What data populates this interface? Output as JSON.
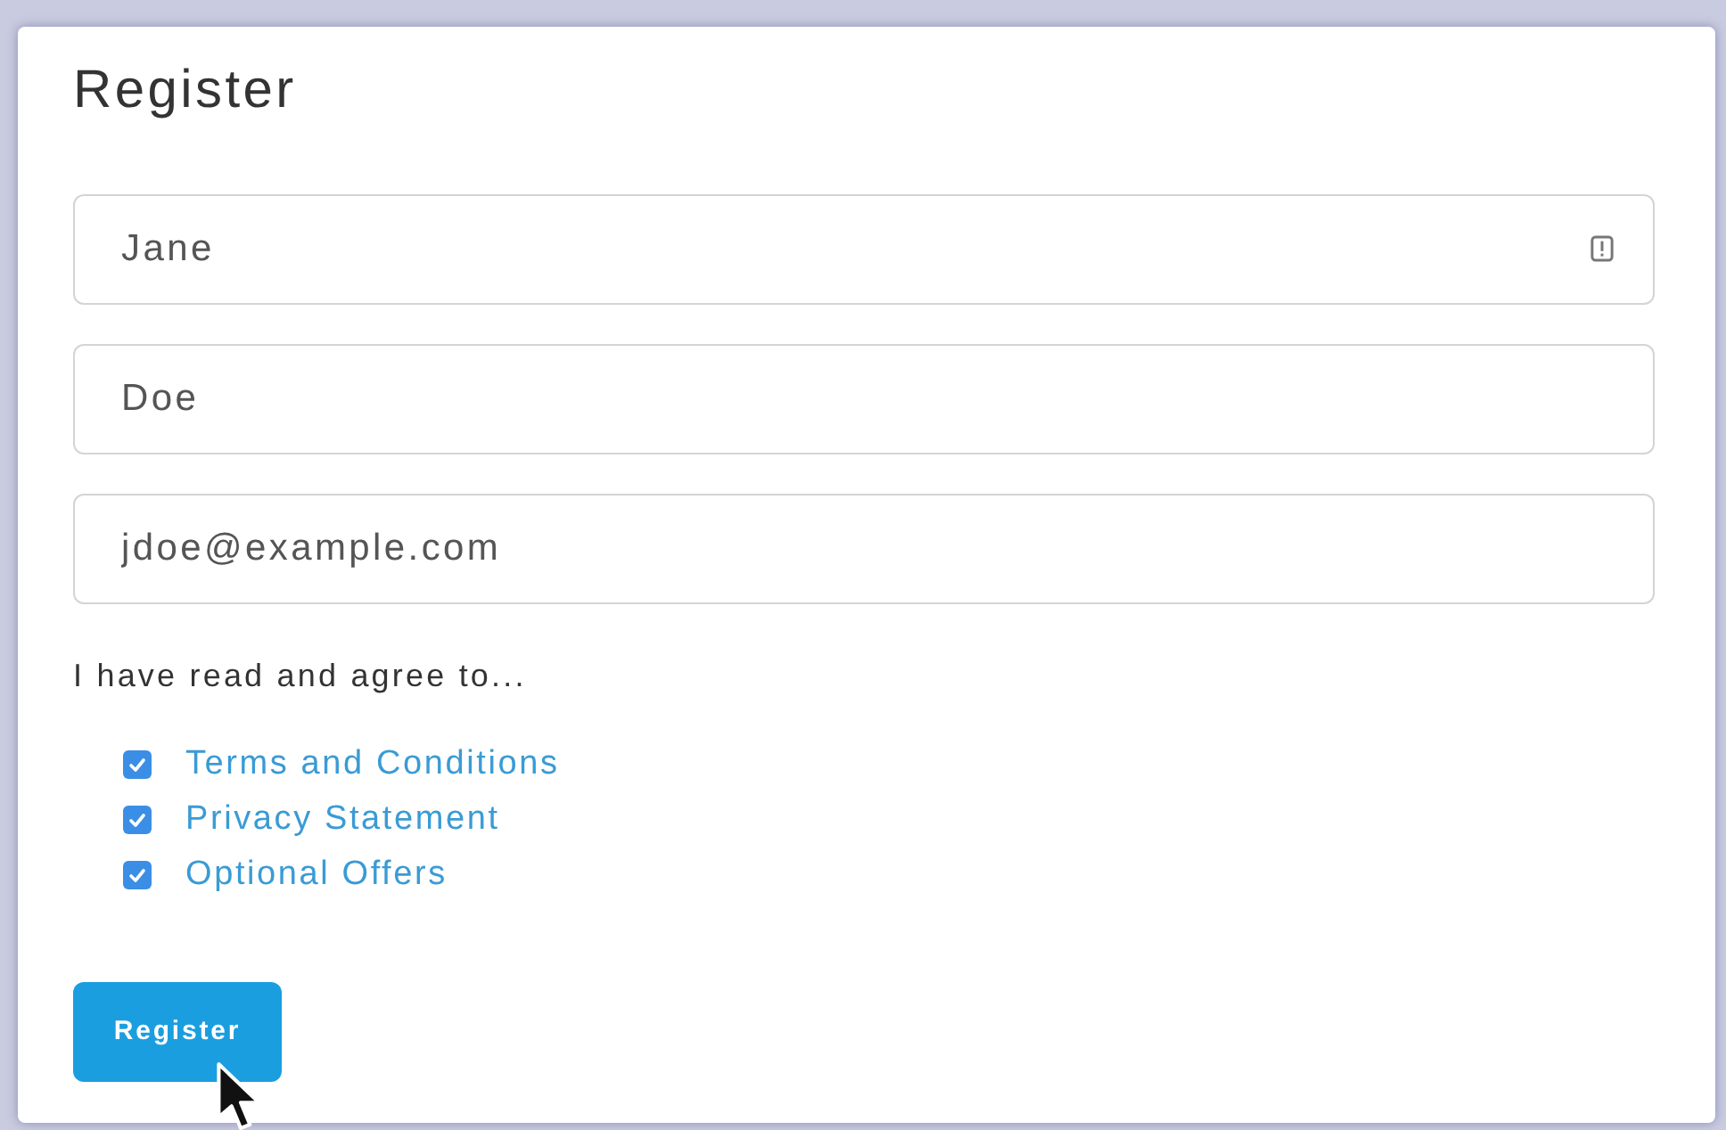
{
  "form": {
    "title": "Register",
    "fields": [
      {
        "value": "Jane",
        "icon": true
      },
      {
        "value": "Doe",
        "icon": false
      },
      {
        "value": "jdoe@example.com",
        "icon": false
      }
    ],
    "agreement_label": "I have read and agree to...",
    "checkboxes": [
      {
        "label": "Terms and Conditions",
        "checked": true
      },
      {
        "label": "Privacy Statement",
        "checked": true
      },
      {
        "label": "Optional Offers",
        "checked": true
      }
    ],
    "submit_button": {
      "label": "Register"
    }
  }
}
